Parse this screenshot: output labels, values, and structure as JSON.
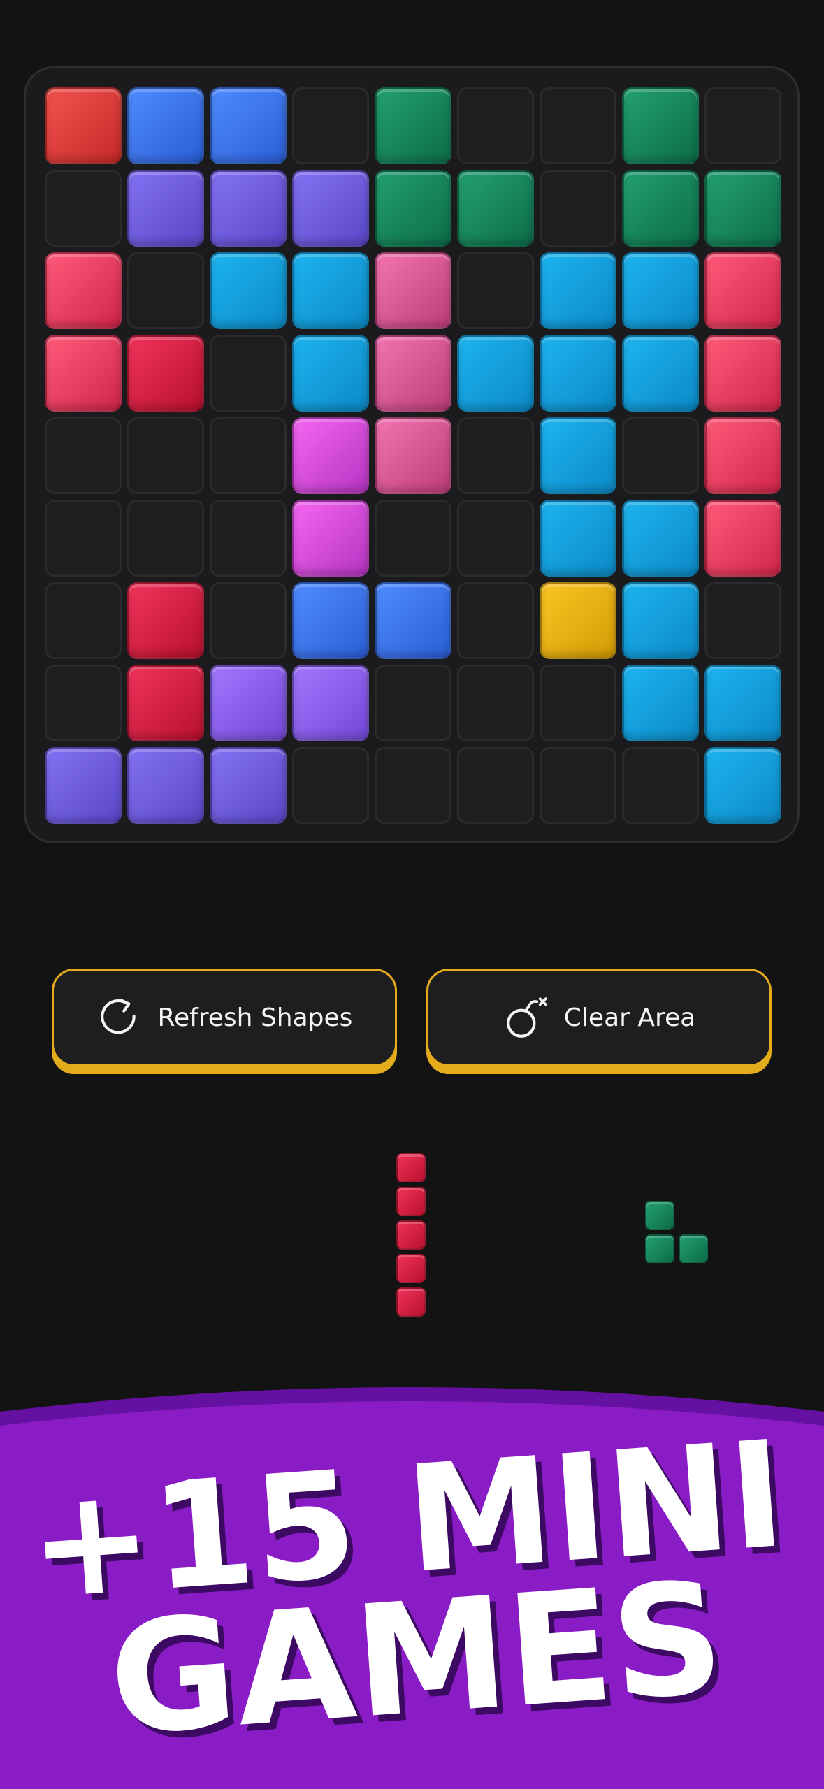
{
  "colors": {
    "background": "#131314",
    "board": "#1b1b1d",
    "empty_cell": "#1e1e20",
    "button_border": "#e4ab1b",
    "banner": "#8a1cc6",
    "banner_text": "#ffffff",
    "banner_text_shadow": "#3d0a63"
  },
  "palette": {
    "R": [
      "#f0524e",
      "#c72a29"
    ],
    "B": [
      "#4f8bff",
      "#2b5fd6"
    ],
    "G": [
      "#23a071",
      "#0d6d49"
    ],
    "P": [
      "#8472f4",
      "#5a48c8"
    ],
    "K": [
      "#ff5a7a",
      "#d2264a"
    ],
    "C": [
      "#1db4f0",
      "#0c8ac7"
    ],
    "N": [
      "#f474b2",
      "#bd3d79"
    ],
    "M": [
      "#f566f2",
      "#b534c2"
    ],
    "L": [
      "#a178ff",
      "#7448d8"
    ],
    "Y": [
      "#fbc624",
      "#d39a05"
    ],
    "D": [
      "#f0335a",
      "#b9112f"
    ]
  },
  "board": {
    "size": 9,
    "rows": [
      "RBB.G..G.",
      ".PPPGG.GG",
      "K.CCN.CCK",
      "KD.CNCCCK",
      "...MN.C.K",
      "...M..CCK",
      ".D.BB.YC.",
      ".DLL...CC",
      "PPP.....C"
    ]
  },
  "actions": {
    "refresh": {
      "label": "Refresh Shapes",
      "icon": "refresh-icon"
    },
    "clear": {
      "label": "Clear Area",
      "icon": "bomb-icon"
    }
  },
  "next_pieces": [
    {
      "color": "D",
      "cells": [
        [
          0,
          0
        ],
        [
          0,
          1
        ],
        [
          0,
          2
        ],
        [
          0,
          3
        ],
        [
          0,
          4
        ]
      ]
    },
    {
      "color": "G",
      "cells": [
        [
          0,
          0
        ],
        [
          0,
          1
        ],
        [
          1,
          1
        ]
      ]
    }
  ],
  "banner": {
    "line1": "+15 MINI",
    "line2": "GAMES"
  }
}
